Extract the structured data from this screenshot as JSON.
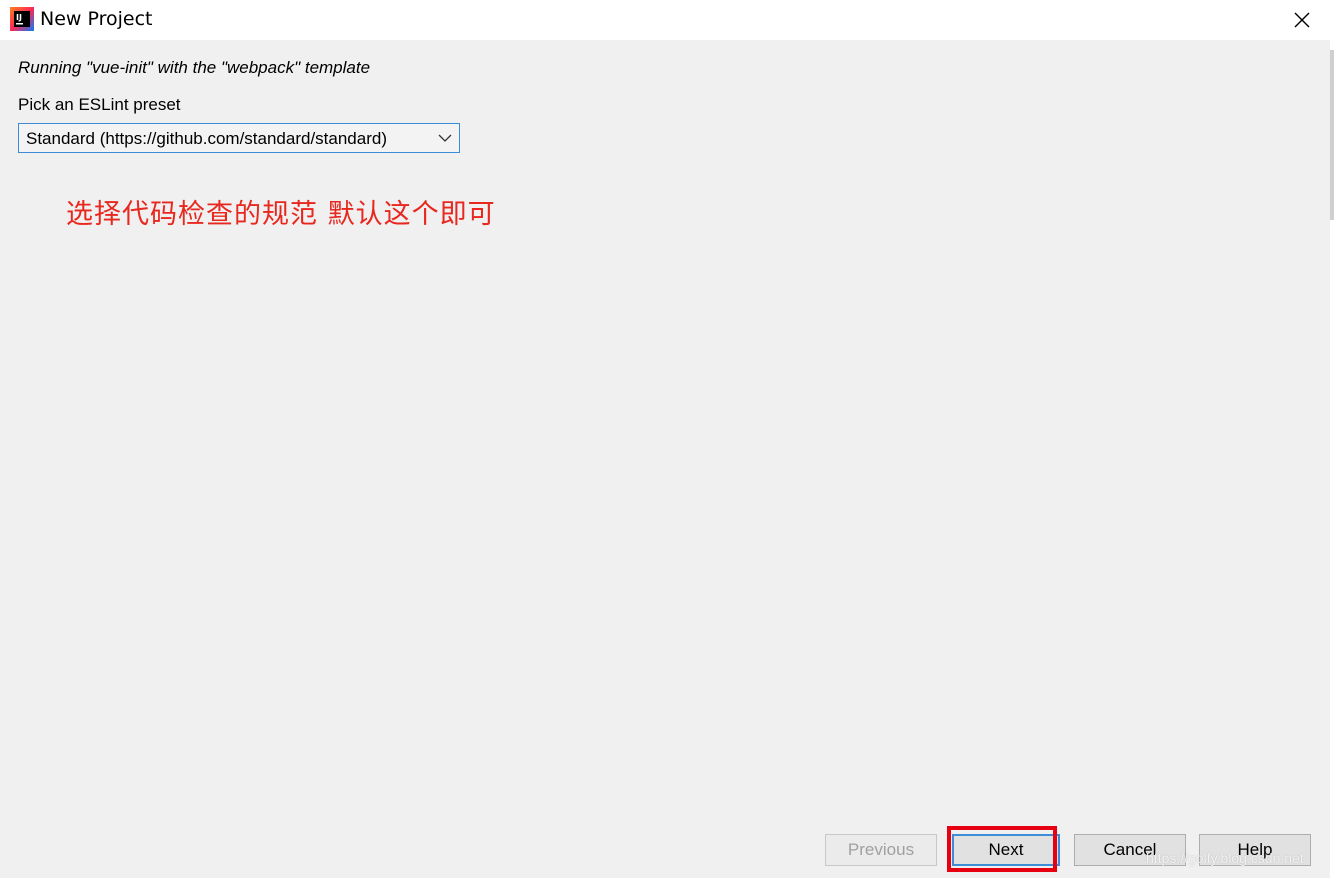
{
  "window": {
    "title": "New Project",
    "close_icon": "close-icon",
    "app_icon": "intellij-idea-icon",
    "app_icon_text": "IJ"
  },
  "content": {
    "status_line": "Running \"vue-init\" with the \"webpack\" template",
    "prompt_label": "Pick an ESLint preset",
    "preset_select": {
      "selected": "Standard (https://github.com/standard/standard)",
      "icon": "chevron-down-icon"
    },
    "annotation": "选择代码检查的规范  默认这个即可",
    "annotation_color": "#e8271e"
  },
  "footer": {
    "previous_label": "Previous",
    "next_label": "Next",
    "cancel_label": "Cancel",
    "help_label": "Help",
    "highlight_color": "#e60012",
    "focus_color": "#3c8cd8"
  },
  "watermark": "https://golfy.blog.csdn.net"
}
